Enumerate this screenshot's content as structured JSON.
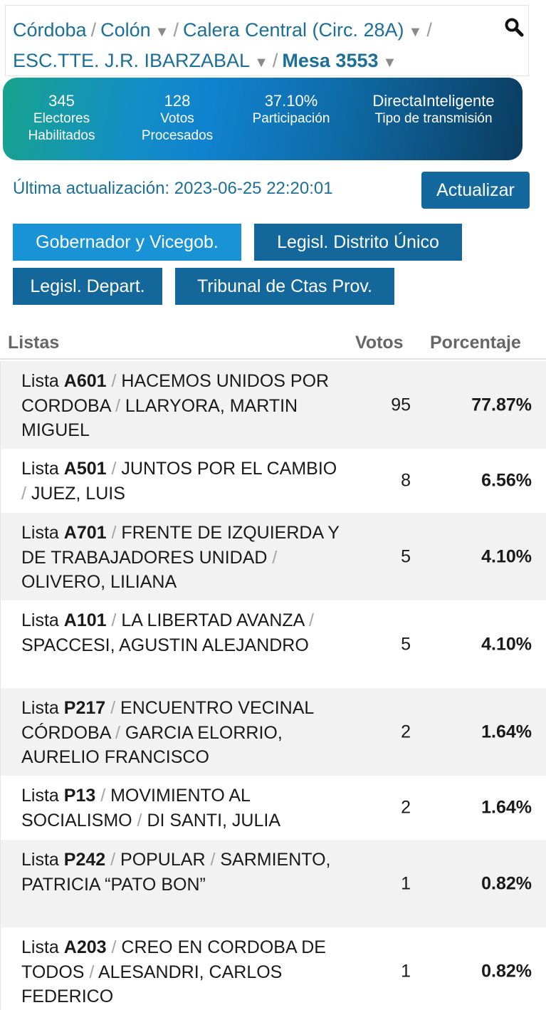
{
  "breadcrumb": {
    "province": "Córdoba",
    "department": "Colón",
    "circuit": "Calera Central (Circ. 28A)",
    "school": "ESC.TTE. J.R. IBARZABAL",
    "table": "Mesa 3553",
    "separator": "/",
    "caret": "▼",
    "search_icon": "search-icon"
  },
  "stats": {
    "electores": {
      "value": "345",
      "label_1": "Electores",
      "label_2": "Habilitados"
    },
    "votos": {
      "value": "128",
      "label_1": "Votos",
      "label_2": "Procesados"
    },
    "participacion": {
      "value": "37.10%",
      "label": "Participación"
    },
    "transmision": {
      "value": "DirectaInteligente",
      "label": "Tipo de transmisión"
    }
  },
  "update": {
    "text": "Última actualización: 2023-06-25 22:20:01",
    "refresh_label": "Actualizar"
  },
  "tabs": [
    {
      "label": "Gobernador y Vicegob.",
      "active": true
    },
    {
      "label": "Legisl. Distrito Único",
      "active": false
    },
    {
      "label": "Legisl. Depart.",
      "active": false
    },
    {
      "label": "Tribunal de Ctas Prov.",
      "active": false
    }
  ],
  "results": {
    "headers": {
      "listas": "Listas",
      "votos": "Votos",
      "porcentaje": "Porcentaje"
    },
    "rows": [
      {
        "prefix": "Lista",
        "code": "A601",
        "party": "HACEMOS UNIDOS POR CORDOBA",
        "candidate": "LLARYORA, MARTIN MIGUEL",
        "votes": "95",
        "percent": "77.87%"
      },
      {
        "prefix": "Lista",
        "code": "A501",
        "party": "JUNTOS POR EL CAMBIO",
        "candidate": "JUEZ, LUIS",
        "votes": "8",
        "percent": "6.56%"
      },
      {
        "prefix": "Lista",
        "code": "A701",
        "party": "FRENTE DE IZQUIERDA Y DE TRABAJADORES UNIDAD",
        "candidate": "OLIVERO, LILIANA",
        "votes": "5",
        "percent": "4.10%"
      },
      {
        "prefix": "Lista",
        "code": "A101",
        "party": "LA LIBERTAD AVANZA",
        "candidate": "SPACCESI, AGUSTIN ALEJANDRO",
        "votes": "5",
        "percent": "4.10%"
      },
      {
        "prefix": "Lista",
        "code": "P217",
        "party": "ENCUENTRO VECINAL CÓRDOBA",
        "candidate": "GARCIA ELORRIO, AURELIO FRANCISCO",
        "votes": "2",
        "percent": "1.64%"
      },
      {
        "prefix": "Lista",
        "code": "P13",
        "party": "MOVIMIENTO AL SOCIALISMO",
        "candidate": "DI SANTI, JULIA",
        "votes": "2",
        "percent": "1.64%"
      },
      {
        "prefix": "Lista",
        "code": "P242",
        "party": "POPULAR",
        "candidate": "SARMIENTO, PATRICIA “PATO BON”",
        "votes": "1",
        "percent": "0.82%"
      },
      {
        "prefix": "Lista",
        "code": "A203",
        "party": "CREO EN CORDOBA DE TODOS",
        "candidate": "ALESANDRI, CARLOS FEDERICO",
        "votes": "1",
        "percent": "0.82%"
      }
    ]
  }
}
